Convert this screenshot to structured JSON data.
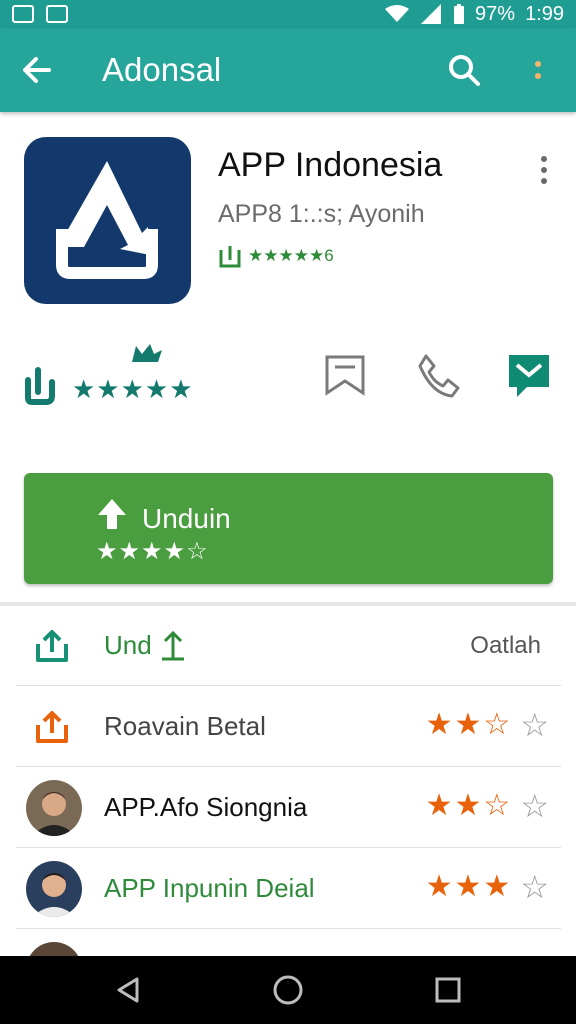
{
  "status_bar": {
    "battery": "97%",
    "time": "1:99"
  },
  "app_bar": {
    "title": "Adonsal"
  },
  "app": {
    "title": "APP Indonesia",
    "subtitle": "APP8 1:.:s; Ayonih",
    "meta_rating": "★★★★★6"
  },
  "rating_stars": "★★★★★",
  "download": {
    "label": "Unduin",
    "stars": "★★★★☆"
  },
  "list": [
    {
      "label": "Und",
      "right": "Oatlah",
      "icon": "upload-icon",
      "label_color": "#2e8b3a"
    },
    {
      "label": "Roavain Betal",
      "icon": "upload-orange-icon",
      "label_color": "#444444"
    },
    {
      "label": "APP.Afo Siongnia",
      "icon": "avatar",
      "label_color": "#111111"
    },
    {
      "label": "APP Inpunin Deial",
      "icon": "avatar",
      "label_color": "#2e8b3a"
    }
  ],
  "colors": {
    "appbar": "#26a69a",
    "statusbar": "#1f9d92",
    "download": "#4a9e3f",
    "accent_green": "#157a6e",
    "star_orange": "#e8620c"
  }
}
